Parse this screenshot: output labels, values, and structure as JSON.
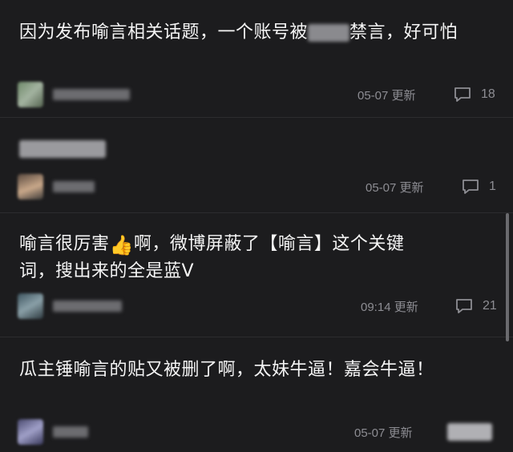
{
  "feed": {
    "posts": [
      {
        "text_before": "因为发布喻言相关话题，一个账号被",
        "text_after": "禁言，好可怕",
        "time": "05-07 更新",
        "comments": "18"
      },
      {
        "text_before": "",
        "text_after": "",
        "time": "05-07 更新",
        "comments": "1"
      },
      {
        "text_before": "喻言很厉害",
        "text_after": "啊，微博屏蔽了【喻言】这个关键词，搜出来的全是蓝V",
        "time": "09:14 更新",
        "comments": "21"
      },
      {
        "text_before": "瓜主锤喻言的贴又被删了啊，太妹牛逼！嘉会牛逼！",
        "text_after": "",
        "time": "05-07 更新",
        "comments": ""
      }
    ]
  },
  "colors": {
    "background": "#1c1c1e",
    "text": "#f5f5f5",
    "meta": "#8d8d93",
    "divider": "#2c2c2f"
  },
  "icons": {
    "comment": "comment-bubble-icon",
    "thumbs_up": "thumbs-up-emoji"
  }
}
